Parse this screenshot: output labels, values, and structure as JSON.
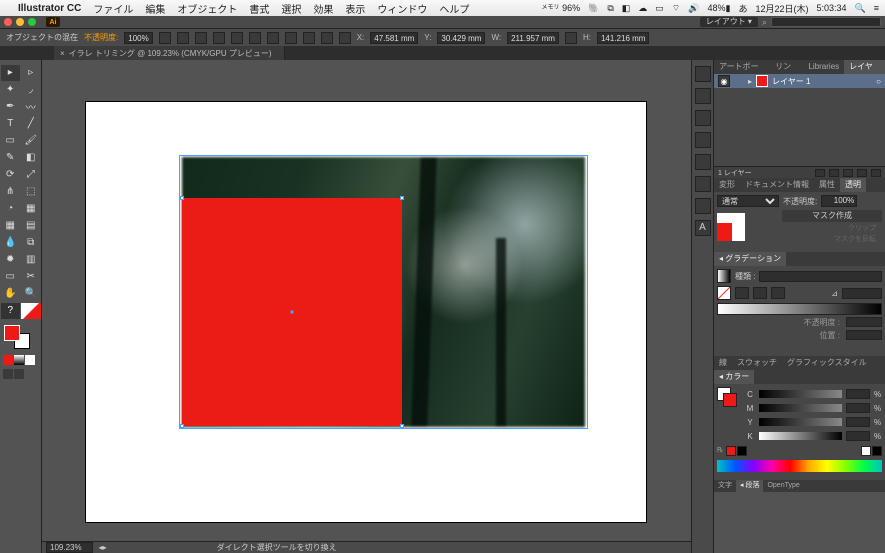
{
  "macmenu": {
    "app_name": "Illustrator CC",
    "items": [
      "ファイル",
      "編集",
      "オブジェクト",
      "書式",
      "選択",
      "効果",
      "表示",
      "ウィンドウ",
      "ヘルプ"
    ],
    "memory_label": "メモリ",
    "memory_value": "96%",
    "battery": "48%",
    "date": "12月22日(木)",
    "time": "5:03:34"
  },
  "app": {
    "icon_text": "Ai",
    "layout_label": "レイアウト ▾",
    "search_icon": "⌕"
  },
  "controlbar": {
    "object_label": "オブジェクトの混在",
    "opacity_label": "不透明度:",
    "opacity_value": "100%",
    "x_label": "X:",
    "x_value": "47.581 mm",
    "y_label": "Y:",
    "y_value": "30.429 mm",
    "w_label": "W:",
    "w_value": "211.957 mm",
    "h_label": "H:",
    "h_value": "141.216 mm"
  },
  "tabs": {
    "doc_title": "イラレ トリミング @ 109.23% (CMYK/GPU プレビュー)"
  },
  "statusbar": {
    "zoom": "109.23%",
    "hint": "ダイレクト選択ツールを切り換え"
  },
  "layers_panel": {
    "tabs": [
      "アートボード",
      "リンク",
      "Libraries",
      "レイヤー"
    ],
    "active_tab": 3,
    "layer1": "レイヤー 1",
    "footer_count": "1 レイヤー"
  },
  "transparency_panel": {
    "tabs": [
      "変形",
      "ドキュメント情報",
      "属性",
      "透明"
    ],
    "active_tab": 3,
    "blend_mode": "通常",
    "opacity_label": "不透明度:",
    "opacity_value": "100%",
    "mask_make": "マスク作成",
    "clip": "クリップ",
    "invert": "マスクを反転"
  },
  "gradient_panel": {
    "title": "グラデーション",
    "type_label": "種類 :",
    "opacity_label": "不透明度 :",
    "location_label": "位置 :"
  },
  "color_panel": {
    "tabs_top": [
      "線",
      "スウォッチ",
      "グラフィックスタイル"
    ],
    "title": "カラー",
    "channels": [
      "C",
      "M",
      "Y",
      "K"
    ],
    "pct": "%"
  },
  "text_panel": {
    "tabs": [
      "文字",
      "段落",
      "OpenType"
    ],
    "active_tab": 1
  }
}
